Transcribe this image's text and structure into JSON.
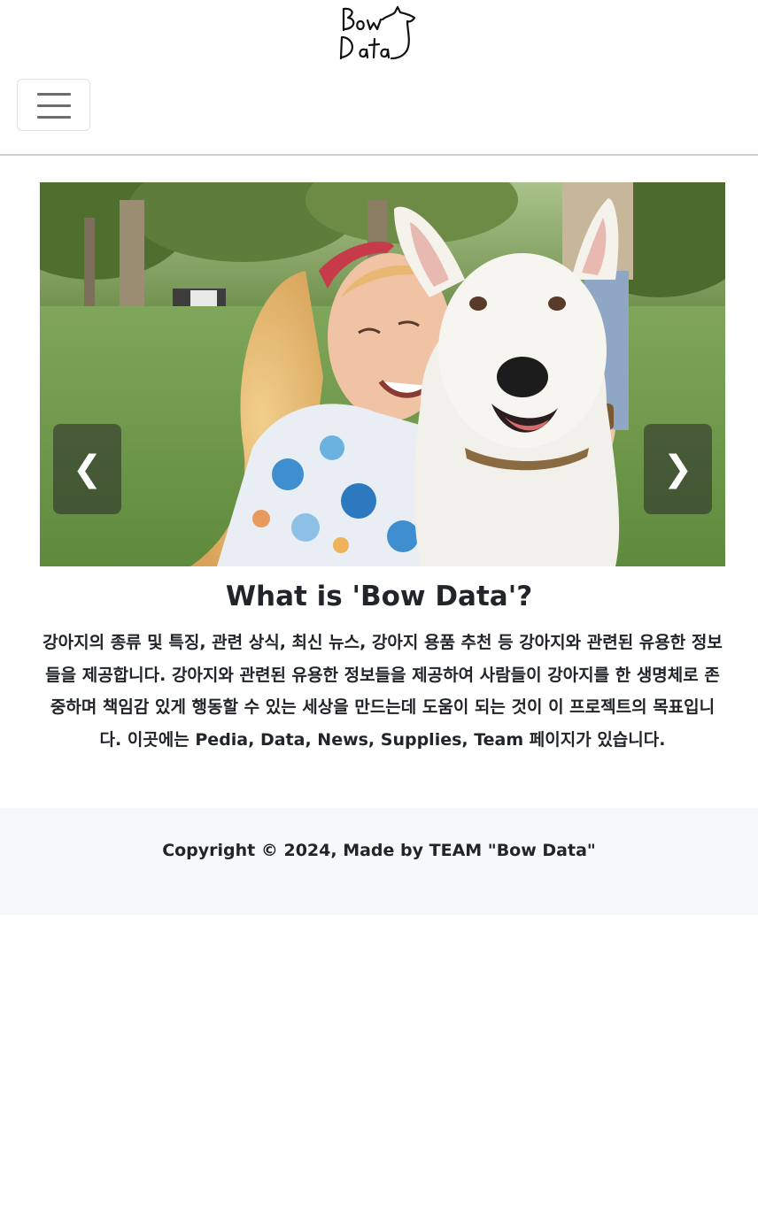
{
  "header": {
    "logo_text_line1": "Bow",
    "logo_text_line2": "Data",
    "menu_icon": "hamburger-menu-icon"
  },
  "carousel": {
    "prev_label": "❮",
    "next_label": "❯",
    "prev_icon": "chevron-left-icon",
    "next_icon": "chevron-right-icon"
  },
  "intro": {
    "title": "What is 'Bow Data'?",
    "text": "강아지의 종류 및 특징, 관련 상식, 최신 뉴스, 강아지 용품 추천 등 강아지와 관련된 유용한 정보들을 제공합니다. 강아지와 관련된 유용한 정보들을 제공하여 사람들이 강아지를 한 생명체로 존중하며 책임감 있게 행동할 수 있는 세상을 만드는데 도움이 되는 것이 이 프로젝트의 목표입니다. 이곳에는 Pedia, Data, News, Supplies, Team 페이지가 있습니다."
  },
  "footer": {
    "copyright": "Copyright © 2024, Made by TEAM \"Bow Data\""
  },
  "colors": {
    "text": "#212529",
    "footer_bg": "#f7f8f9",
    "divider": "#cfcfcf",
    "carousel_control_bg": "rgba(40,40,40,0.55)"
  }
}
